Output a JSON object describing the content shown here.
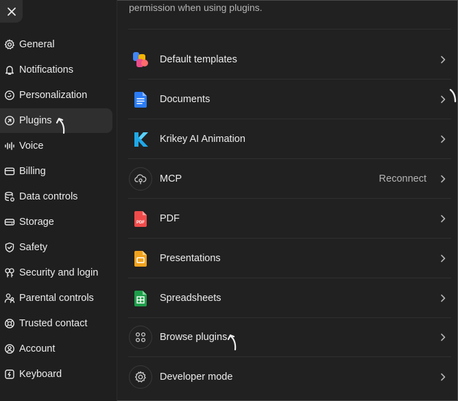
{
  "sidebar": {
    "close_icon": "close-icon",
    "items": [
      {
        "label": "General",
        "icon": "gear-icon",
        "active": false
      },
      {
        "label": "Notifications",
        "icon": "bell-icon",
        "active": false
      },
      {
        "label": "Personalization",
        "icon": "clock-icon",
        "active": false
      },
      {
        "label": "Plugins",
        "icon": "plugin-icon",
        "active": true
      },
      {
        "label": "Voice",
        "icon": "waveform-icon",
        "active": false
      },
      {
        "label": "Billing",
        "icon": "card-icon",
        "active": false
      },
      {
        "label": "Data controls",
        "icon": "database-icon",
        "active": false
      },
      {
        "label": "Storage",
        "icon": "storage-icon",
        "active": false
      },
      {
        "label": "Safety",
        "icon": "shield-icon",
        "active": false
      },
      {
        "label": "Security and login",
        "icon": "lock-icon",
        "active": false
      },
      {
        "label": "Parental controls",
        "icon": "people-icon",
        "active": false
      },
      {
        "label": "Trusted contact",
        "icon": "lifebuoy-icon",
        "active": false
      },
      {
        "label": "Account",
        "icon": "account-icon",
        "active": false
      },
      {
        "label": "Keyboard",
        "icon": "keyboard-icon",
        "active": false
      }
    ]
  },
  "main": {
    "intro_text": "permission when using plugins.",
    "rows": [
      {
        "label": "Default templates",
        "icon": "templates-icon",
        "status": ""
      },
      {
        "label": "Documents",
        "icon": "document-icon",
        "status": ""
      },
      {
        "label": "Krikey AI Animation",
        "icon": "krikey-icon",
        "status": ""
      },
      {
        "label": "MCP",
        "icon": "cloud-plug-icon",
        "status": "Reconnect"
      },
      {
        "label": "PDF",
        "icon": "pdf-icon",
        "status": "",
        "icon_text": "PDF"
      },
      {
        "label": "Presentations",
        "icon": "presentation-icon",
        "status": ""
      },
      {
        "label": "Spreadsheets",
        "icon": "spreadsheet-icon",
        "status": ""
      },
      {
        "label": "Browse plugins",
        "icon": "grid-icon",
        "status": ""
      },
      {
        "label": "Developer mode",
        "icon": "gear-icon",
        "status": ""
      }
    ]
  },
  "colors": {
    "background": "#212121",
    "sidebar": "#1f1f1f",
    "active_item": "#2f2f2f",
    "text": "#ececec",
    "muted_text": "#b4b4b4",
    "divider": "#303030"
  }
}
